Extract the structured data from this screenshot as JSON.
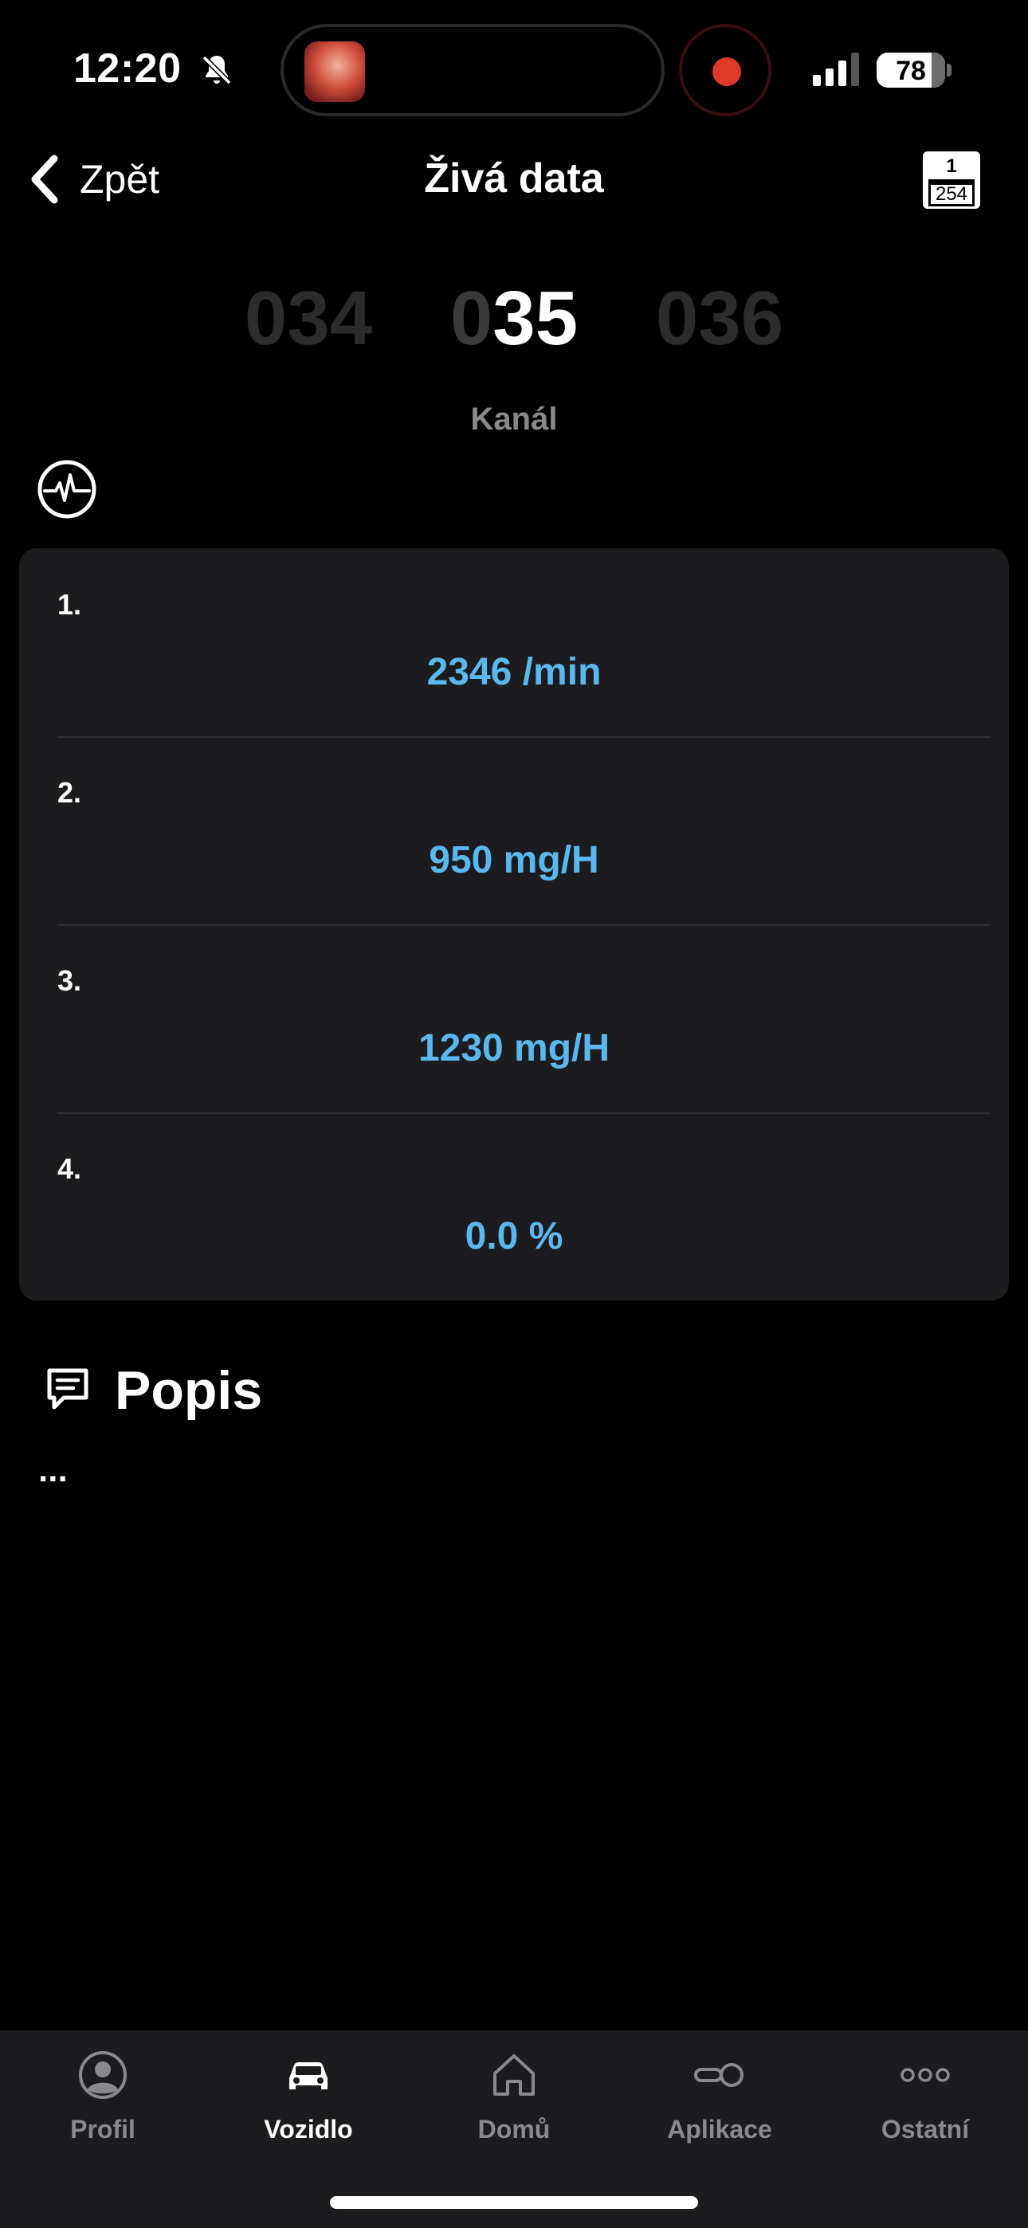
{
  "status_bar": {
    "time": "12:20",
    "battery_level": "78",
    "icons": [
      "bell-slash-icon",
      "signal-icon",
      "battery-icon",
      "record-icon"
    ]
  },
  "nav": {
    "back_label": "Zpět",
    "title": "Živá data",
    "range_badge": {
      "top": "1",
      "bottom": "254"
    }
  },
  "channel": {
    "prev": "034",
    "current_prefix": "0",
    "current_main": "35",
    "next": "036",
    "label": "Kanál"
  },
  "data_rows": [
    {
      "index": "1.",
      "value": "2346 /min"
    },
    {
      "index": "2.",
      "value": "950 mg/H"
    },
    {
      "index": "3.",
      "value": "1230 mg/H"
    },
    {
      "index": "4.",
      "value": "0.0 %"
    }
  ],
  "description": {
    "title": "Popis",
    "text": "..."
  },
  "tab_bar": {
    "items": [
      {
        "label": "Profil",
        "icon": "profile-icon",
        "active": false
      },
      {
        "label": "Vozidlo",
        "icon": "car-icon",
        "active": true
      },
      {
        "label": "Domů",
        "icon": "home-icon",
        "active": false
      },
      {
        "label": "Aplikace",
        "icon": "toggle-icon",
        "active": false
      },
      {
        "label": "Ostatní",
        "icon": "more-icon",
        "active": false
      }
    ]
  },
  "colors": {
    "background": "#000000",
    "card": "#1c1c1e",
    "value_accent": "#5ab8f0",
    "inactive_tab": "#8a8a8e",
    "record": "#e0392b"
  }
}
